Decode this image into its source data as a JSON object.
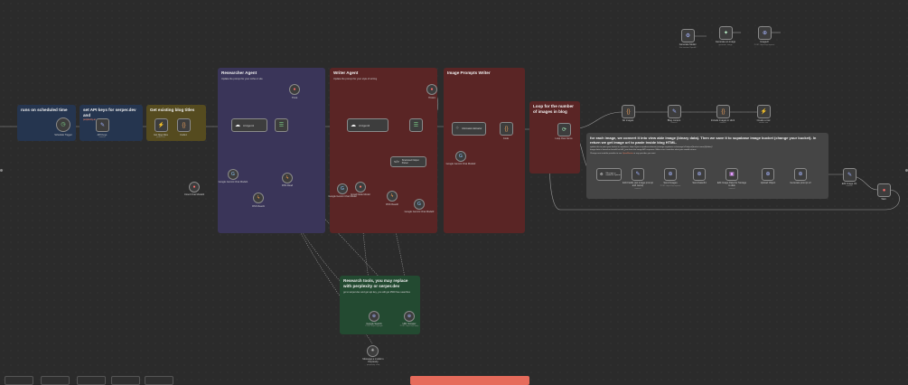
{
  "stickies": {
    "scheduled": {
      "title": "runs on scheduled time"
    },
    "apikeys": {
      "title": "set API keys for serper.dev and",
      "link": "perplexity.ai"
    },
    "existing": {
      "title": "Get existing blog titles"
    },
    "researcher": {
      "title": "Researcher Agent",
      "sub": "Update the prompt for your niche or site"
    },
    "writer": {
      "title": "Writer Agent",
      "sub": "Update the prompt for your style of writing"
    },
    "imageprompts": {
      "title": "Image Prompts Writer"
    },
    "loop": {
      "title": "Loop for the number of images in blog"
    },
    "foreach": {
      "title": "for each image, we convert it into view able image (binary data). Then we save it to supabase image bucket (change your bucket). In return we get image url to paste inside blog HTML.",
      "sub1": "update this to point your bucket in supabase: https://{your-supabase-domain}.storage.supabase.co/storage/v1/object/{bucket-name}/{folder}/",
      "sub2": "Image data is based on base64 or b64_json from the image API response. Make sure it matches what your model returns.",
      "sub3": "Change next module provider to use",
      "sub3link": "OpenRouter",
      "sub3end": "or any provider you want"
    },
    "research": {
      "title": "Research tools, you may replace with perplexity or serper.dev",
      "sub": "go to serper.dev and get api key, you will get 2500 free searches"
    }
  },
  "nodes": {
    "trigger": {
      "label": "Schedule Trigger"
    },
    "apikeys": {
      "label": "API Keys",
      "sub": "manual"
    },
    "getrows": {
      "label": "Get blog titles",
      "sub": "getAll: row"
    },
    "code1": {
      "label": "Code1"
    },
    "aiagent1": {
      "label": "AI Agent1"
    },
    "think1": {
      "label": "Think"
    },
    "parser1": {
      "label": "Structured"
    },
    "gemini1": {
      "label": "Google Gemini Chat Model1"
    },
    "rss1": {
      "label": "RSS Read"
    },
    "rss2": {
      "label": "RSS Read1"
    },
    "aiagent2": {
      "label": "AI Agent2"
    },
    "gemini2": {
      "label": "Google Gemini Chat Model"
    },
    "fromhttp": {
      "label": "Email Node Model"
    },
    "rss3": {
      "label": "RSS Read2"
    },
    "gemini3": {
      "label": "Google Gemini Chat Model3"
    },
    "structured": {
      "label": "Structured Output Parser"
    },
    "think2": {
      "label": "Think1"
    },
    "infoextract": {
      "label": "Information Extractor"
    },
    "gemini4": {
      "label": "Google Gemini Chat Model2"
    },
    "code2": {
      "label": "Code"
    },
    "loop": {
      "label": "Loop Over Items"
    },
    "floatchat": {
      "label": "Cloud Chat Model2"
    },
    "top1": {
      "label": "Generate Model",
      "sub": "Use custom OpenAI"
    },
    "top2": {
      "label": "Generate an image",
      "sub": "generate: image"
    },
    "top3": {
      "label": "ImageAI",
      "sub": "POST: https://api.openai"
    },
    "r1": {
      "label": "No images"
    },
    "r2": {
      "label": "Blog content",
      "sub": "manual"
    },
    "r3": {
      "label": "Include images in Html",
      "sub": "manual"
    },
    "r4": {
      "label": "Create a row",
      "sub": "create: row"
    },
    "msgmodel": {
      "label": "Message a model in Openai"
    },
    "f1": {
      "label": "Edit Fields (set image prompt and name)",
      "sub": "manual"
    },
    "f2": {
      "label": "Send Images",
      "sub": "POST: https://api.openai"
    },
    "f3": {
      "label": "Send base64"
    },
    "f4": {
      "label": "Edit Image Data for Storage to disk",
      "sub": "manual"
    },
    "f5": {
      "label": "Upload Object"
    },
    "f6": {
      "label": "Generate prompt url"
    },
    "f7": {
      "label": "Edit Image Url",
      "sub": "manual"
    },
    "f8": {
      "label": "Wait"
    },
    "gsearch": {
      "label": "Google Search",
      "sub": "POST: https://google"
    },
    "urlscrape": {
      "label": "URL Scraper",
      "sub": "POST: https://api.apify"
    },
    "perplexity": {
      "label": "Message a model in Perplexity",
      "sub": "perplexity: chat"
    }
  },
  "colors": {
    "blue": "#25354f",
    "olive": "#554b1f",
    "purple": "#3a3559",
    "red": "#5a2525",
    "green": "#234a31",
    "grey": "#454545",
    "wire": "#9a9a9a"
  },
  "icons": {
    "trigger": "clock-icon",
    "edit": "pencil-icon",
    "code": "braces-icon",
    "agent": "robot-icon",
    "stop": "stop-icon",
    "loop": "loop-icon",
    "gemini": "gemini-icon",
    "rss": "rss-icon",
    "openai": "openai-icon",
    "supabase": "supabase-icon"
  }
}
